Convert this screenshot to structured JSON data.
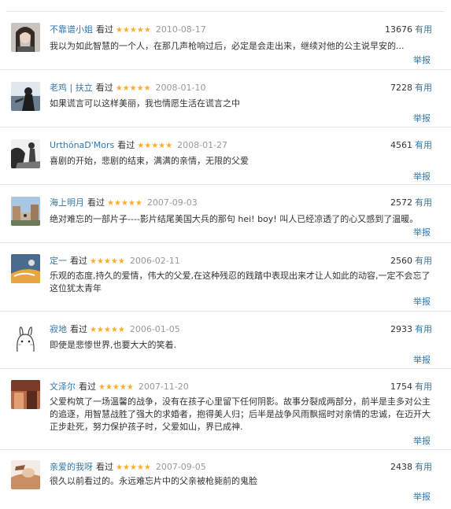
{
  "action_useful": "有用",
  "action_report": "举报",
  "watched_label": "看过",
  "stars_glyph": "★★★★★",
  "accent_color": "#3377aa",
  "star_color": "#ffac2d",
  "comments": [
    {
      "user": "不靠谱小姐",
      "date": "2010-08-17",
      "votes": "13676",
      "text": "我以为如此智慧的一个人，在那几声枪响过后，必定是会走出来，继续对他的公主说早安的..."
    },
    {
      "user": "老鸡 | 扶立",
      "date": "2008-01-10",
      "votes": "7228",
      "text": "如果谎言可以这样美丽，我也情愿生活在谎言之中"
    },
    {
      "user": "UrthónaD'Mors",
      "date": "2008-01-27",
      "votes": "4561",
      "text": "喜剧的开始，悲剧的结束，满满的亲情，无限的父爱"
    },
    {
      "user": "海上明月",
      "date": "2007-09-03",
      "votes": "2572",
      "text": "绝对难忘的一部片子----影片结尾美国大兵的那句 hei! boy! 叫人已经凉透了的心又感到了温暖。"
    },
    {
      "user": "定一",
      "date": "2006-02-11",
      "votes": "2560",
      "text": "乐观的态度,持久的爱情，伟大的父爱,在这种残忍的践踏中表现出来才让人如此的动容,一定不会忘了这位犹太青年"
    },
    {
      "user": "寂地",
      "date": "2006-01-05",
      "votes": "2933",
      "text": "即使是悲惨世界,也要大大的笑着."
    },
    {
      "user": "文泽尔",
      "date": "2007-11-20",
      "votes": "1754",
      "text": "父爱构筑了一场温馨的战争，没有在孩子心里留下任何阴影。故事分裂成两部分，前半是圭多对公主的追逐，用智慧战胜了强大的求婚者，抱得美人归；后半是战争风雨飘摇时对亲情的忠诚，在迈开大正步赴死，努力保护孩子时，父爱如山，界已成神."
    },
    {
      "user": "亲爱的我呀",
      "date": "2007-09-05",
      "votes": "2438",
      "text": "很久以前看过的。永远难忘片中的父亲被枪毙前的鬼脸"
    }
  ]
}
